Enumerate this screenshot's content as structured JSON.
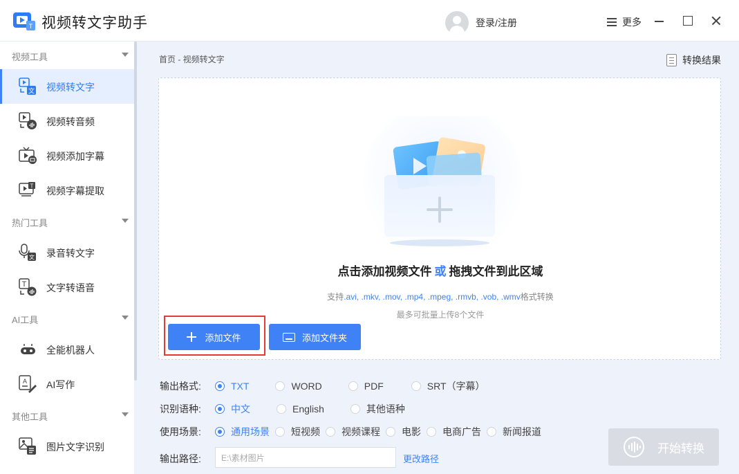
{
  "app": {
    "title": "视频转文字助手"
  },
  "header": {
    "login_label": "登录/注册",
    "more_label": "更多"
  },
  "sidebar": {
    "sections": [
      {
        "label": "视频工具",
        "items": [
          {
            "label": "视频转文字",
            "icon": "video-to-text-icon",
            "active": true
          },
          {
            "label": "视频转音频",
            "icon": "video-to-audio-icon"
          },
          {
            "label": "视频添加字幕",
            "icon": "add-subtitle-icon"
          },
          {
            "label": "视频字幕提取",
            "icon": "extract-subtitle-icon"
          }
        ]
      },
      {
        "label": "热门工具",
        "items": [
          {
            "label": "录音转文字",
            "icon": "recording-to-text-icon"
          },
          {
            "label": "文字转语音",
            "icon": "text-to-speech-icon"
          }
        ]
      },
      {
        "label": "AI工具",
        "items": [
          {
            "label": "全能机器人",
            "icon": "robot-icon"
          },
          {
            "label": "AI写作",
            "icon": "ai-writing-icon"
          }
        ]
      },
      {
        "label": "其他工具",
        "items": [
          {
            "label": "图片文字识别",
            "icon": "image-ocr-icon"
          }
        ]
      }
    ]
  },
  "main": {
    "breadcrumb": "首页 - 视频转文字",
    "result_label": "转换结果",
    "dropzone": {
      "title_part1": "点击添加视频文件",
      "title_or": "或",
      "title_part2": "拖拽文件到此区域",
      "formats_prefix": "支持",
      "formats": ".avi, .mkv, .mov, .mp4, .mpeg, .rmvb, .vob, .wmv",
      "formats_suffix": "格式转换",
      "limit": "最多可批量上传8个文件"
    },
    "add_file_label": "添加文件",
    "add_folder_label": "添加文件夹"
  },
  "options": {
    "format": {
      "label": "输出格式:",
      "choices": [
        "TXT",
        "WORD",
        "PDF",
        "SRT（字幕）"
      ],
      "selected": "TXT"
    },
    "language": {
      "label": "识别语种:",
      "choices": [
        "中文",
        "English",
        "其他语种"
      ],
      "selected": "中文"
    },
    "scene": {
      "label": "使用场景:",
      "choices": [
        "通用场景",
        "短视频",
        "视频课程",
        "电影",
        "电商广告",
        "新闻报道"
      ],
      "selected": "通用场景"
    },
    "output_path": {
      "label": "输出路径:",
      "value": "E:\\素材图片",
      "change_label": "更改路径"
    }
  },
  "start_label": "开始转换",
  "colors": {
    "accent": "#3f82f6",
    "highlight": "#e53935",
    "disabled": "#d9dde3"
  }
}
